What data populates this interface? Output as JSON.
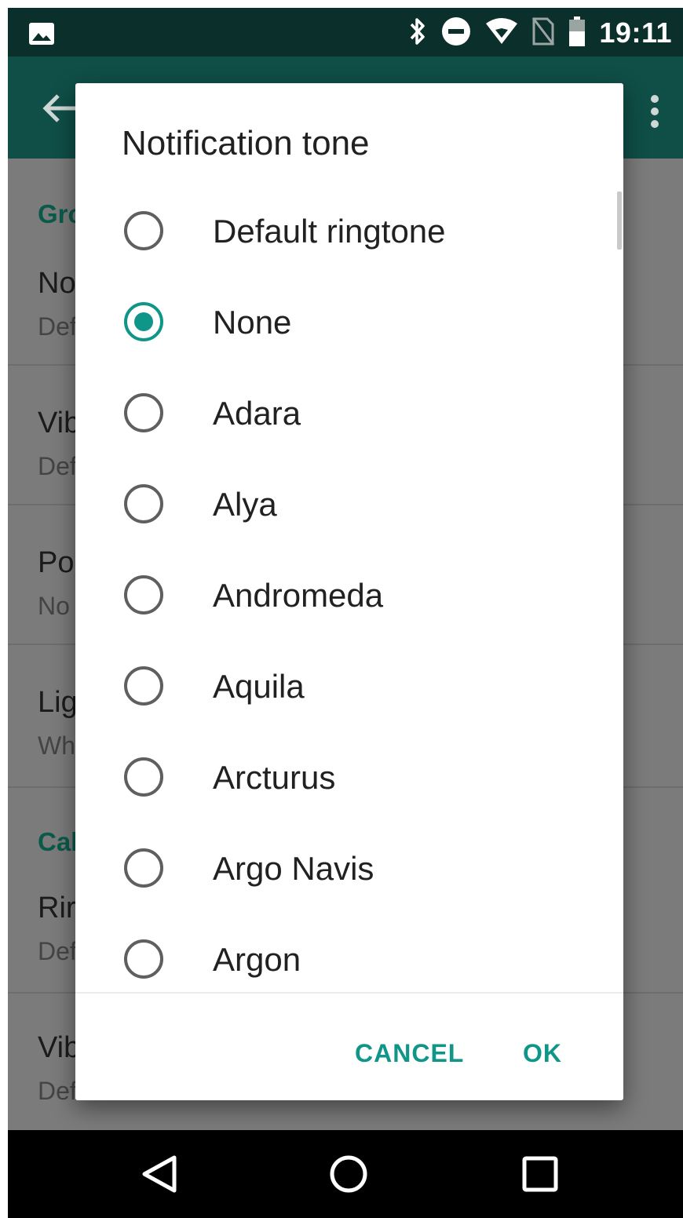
{
  "status_bar": {
    "time": "19:11",
    "icons": [
      "image-icon",
      "bluetooth-icon",
      "do-not-disturb-icon",
      "wifi-icon",
      "no-sim-icon",
      "battery-icon"
    ]
  },
  "toolbar": {
    "icons": [
      "back-arrow-icon",
      "overflow-menu-icon"
    ]
  },
  "background_settings": {
    "items": [
      {
        "kind": "header",
        "text": "Gro"
      },
      {
        "kind": "title",
        "text": "No"
      },
      {
        "kind": "sub",
        "text": "Def"
      },
      {
        "kind": "title",
        "text": "Vib"
      },
      {
        "kind": "sub",
        "text": "Def"
      },
      {
        "kind": "title",
        "text": "Po"
      },
      {
        "kind": "sub",
        "text": "No"
      },
      {
        "kind": "title",
        "text": "Lig"
      },
      {
        "kind": "sub",
        "text": "Wh"
      },
      {
        "kind": "header",
        "text": "Cal"
      },
      {
        "kind": "title",
        "text": "Rir"
      },
      {
        "kind": "sub",
        "text": "Def"
      },
      {
        "kind": "title",
        "text": "Vib"
      },
      {
        "kind": "sub",
        "text": "Def"
      }
    ]
  },
  "dialog": {
    "title": "Notification tone",
    "options": [
      {
        "label": "Default ringtone",
        "checked": false
      },
      {
        "label": "None",
        "checked": true
      },
      {
        "label": "Adara",
        "checked": false
      },
      {
        "label": "Alya",
        "checked": false
      },
      {
        "label": "Andromeda",
        "checked": false
      },
      {
        "label": "Aquila",
        "checked": false
      },
      {
        "label": "Arcturus",
        "checked": false
      },
      {
        "label": "Argo Navis",
        "checked": false
      },
      {
        "label": "Argon",
        "checked": false
      }
    ],
    "cancel_label": "CANCEL",
    "ok_label": "OK"
  },
  "navigation_bar": {
    "icons": [
      "back-triangle-icon",
      "home-circle-icon",
      "recents-square-icon"
    ]
  },
  "colors": {
    "accent": "#0f9688",
    "toolbar": "#0f4f47",
    "status_bar": "#0b2f2a"
  }
}
